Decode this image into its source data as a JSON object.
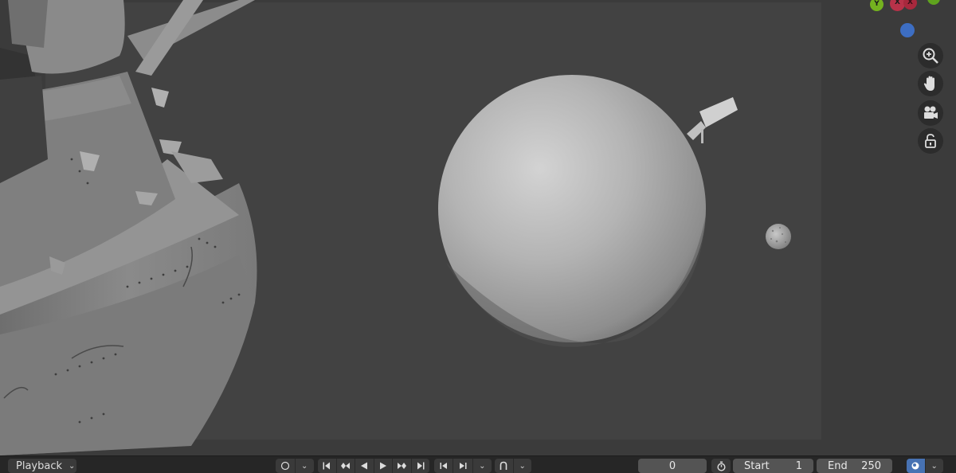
{
  "timeline": {
    "playback_label": "Playback",
    "current_frame": "0",
    "start_label": "Start",
    "start_value": "1",
    "end_label": "End",
    "end_value": "250"
  },
  "gizmo": {
    "y_label": "Y",
    "x_label": "X",
    "x_neg_label": "X"
  },
  "colors": {
    "axis_x": "#b83249",
    "axis_y": "#74b21f",
    "axis_z": "#3d6ec3",
    "active_toggle": "#4772b3"
  },
  "icons": [
    "zoom-in-icon",
    "hand-pan-icon",
    "camera-view-icon",
    "lock-icon",
    "keying-icon",
    "jump-start-icon",
    "prev-keyframe-icon",
    "play-reverse-icon",
    "play-icon",
    "next-keyframe-icon",
    "jump-end-icon",
    "prev-frame-icon",
    "next-frame-icon",
    "snap-icon",
    "stopwatch-icon",
    "globe-toggle-icon"
  ]
}
